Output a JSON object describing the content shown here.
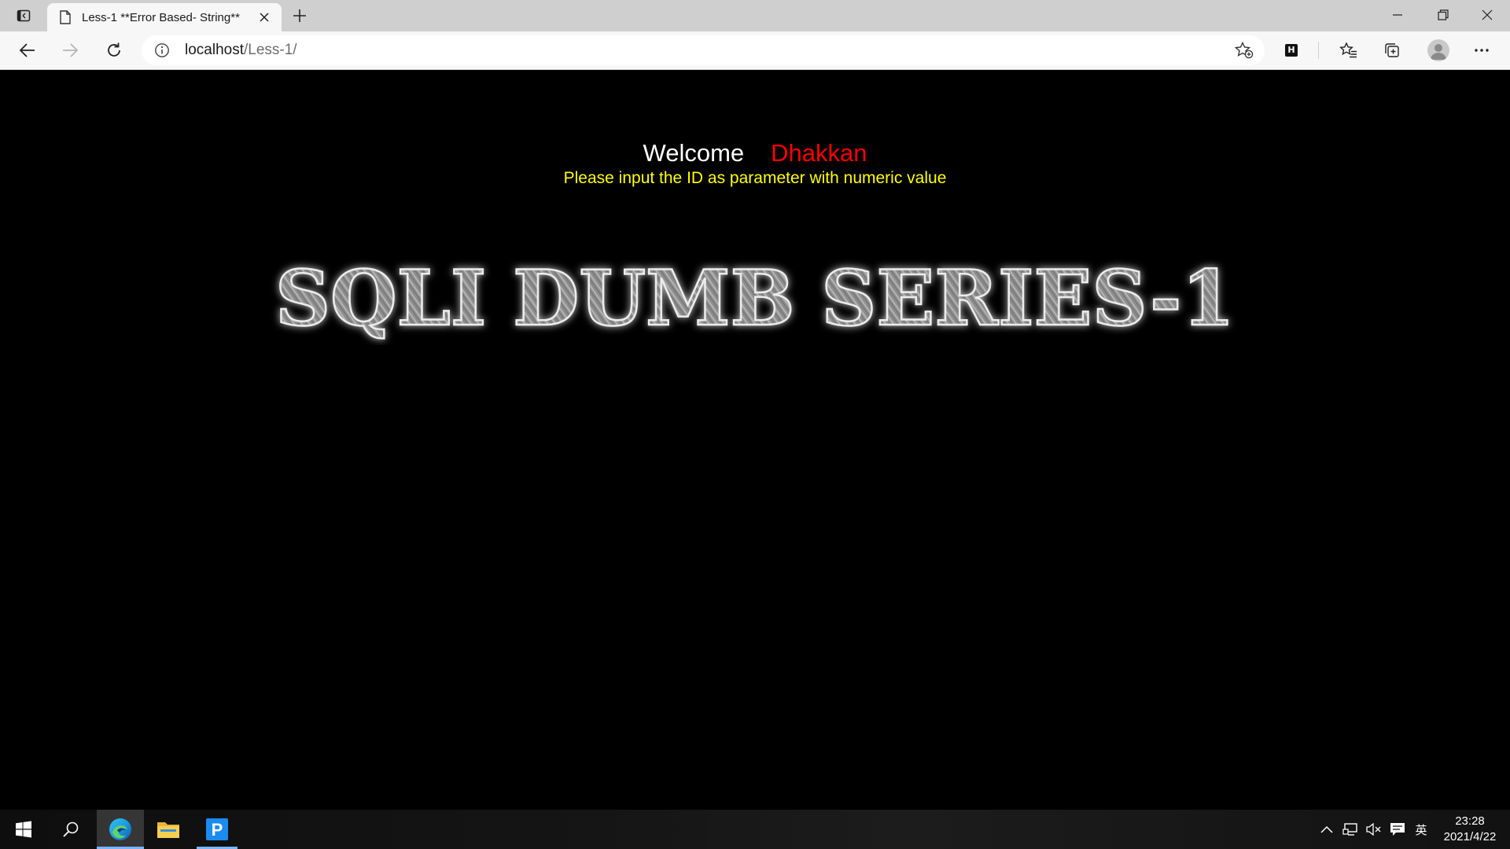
{
  "browser": {
    "tab": {
      "title": "Less-1 **Error Based- String**"
    },
    "address_bar": {
      "host": "localhost",
      "path": "/Less-1/"
    },
    "extension_label": "H"
  },
  "page": {
    "welcome_word": "Welcome",
    "welcome_name": "Dhakkan",
    "instruction": "Please input the ID as parameter with numeric value",
    "banner_text": "SQLI DUMB SERIES-1"
  },
  "taskbar": {
    "pinned_apps": [
      "windows-start",
      "search",
      "edge",
      "file-explorer",
      "p-app"
    ],
    "tray": {
      "input_language": "英"
    },
    "clock": {
      "time": "23:28",
      "date": "2021/4/22"
    }
  },
  "colors": {
    "welcome_word": "#ffffff",
    "welcome_name": "#ff0000",
    "instruction": "#ffff00",
    "page_background": "#000000"
  }
}
